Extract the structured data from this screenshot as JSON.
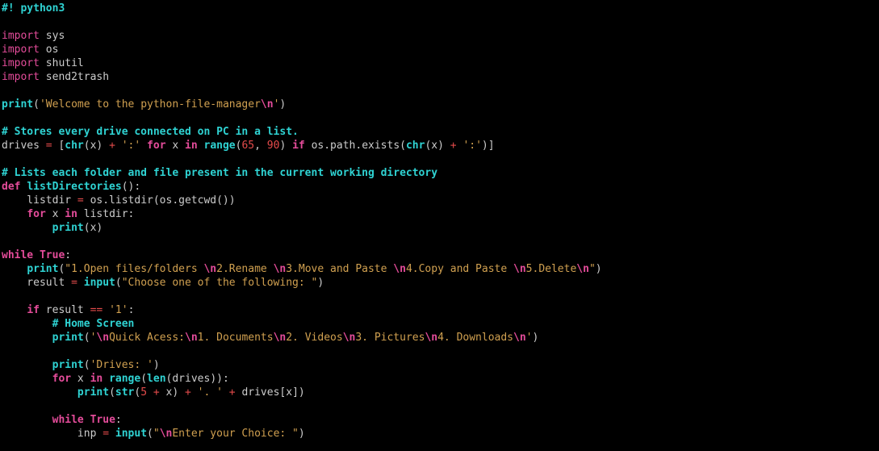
{
  "lines": [
    [
      {
        "cls": "cyan bold",
        "t": "#! python3"
      }
    ],
    [
      {
        "cls": "grey",
        "t": ""
      }
    ],
    [
      {
        "cls": "magenta",
        "t": "import"
      },
      {
        "cls": "grey",
        "t": " sys"
      }
    ],
    [
      {
        "cls": "magenta",
        "t": "import"
      },
      {
        "cls": "grey",
        "t": " os"
      }
    ],
    [
      {
        "cls": "magenta",
        "t": "import"
      },
      {
        "cls": "grey",
        "t": " shutil"
      }
    ],
    [
      {
        "cls": "magenta",
        "t": "import"
      },
      {
        "cls": "grey",
        "t": " send2trash"
      }
    ],
    [
      {
        "cls": "grey",
        "t": ""
      }
    ],
    [
      {
        "cls": "cyan bold",
        "t": "print"
      },
      {
        "cls": "grey",
        "t": "("
      },
      {
        "cls": "orange",
        "t": "'Welcome to the python-file-manager"
      },
      {
        "cls": "magenta bold",
        "t": "\\n"
      },
      {
        "cls": "orange",
        "t": "'"
      },
      {
        "cls": "grey",
        "t": ")"
      }
    ],
    [
      {
        "cls": "grey",
        "t": ""
      }
    ],
    [
      {
        "cls": "cyan bold",
        "t": "# Stores every drive connected on PC in a list."
      }
    ],
    [
      {
        "cls": "grey",
        "t": "drives "
      },
      {
        "cls": "red",
        "t": "="
      },
      {
        "cls": "grey",
        "t": " ["
      },
      {
        "cls": "cyan bold",
        "t": "chr"
      },
      {
        "cls": "grey",
        "t": "(x) "
      },
      {
        "cls": "red",
        "t": "+"
      },
      {
        "cls": "grey",
        "t": " "
      },
      {
        "cls": "orange",
        "t": "':'"
      },
      {
        "cls": "grey",
        "t": " "
      },
      {
        "cls": "magenta bold",
        "t": "for"
      },
      {
        "cls": "grey",
        "t": " x "
      },
      {
        "cls": "magenta bold",
        "t": "in"
      },
      {
        "cls": "grey",
        "t": " "
      },
      {
        "cls": "cyan bold",
        "t": "range"
      },
      {
        "cls": "grey",
        "t": "("
      },
      {
        "cls": "red",
        "t": "65"
      },
      {
        "cls": "grey",
        "t": ", "
      },
      {
        "cls": "red",
        "t": "90"
      },
      {
        "cls": "grey",
        "t": ") "
      },
      {
        "cls": "magenta bold",
        "t": "if"
      },
      {
        "cls": "grey",
        "t": " os.path.exists("
      },
      {
        "cls": "cyan bold",
        "t": "chr"
      },
      {
        "cls": "grey",
        "t": "(x) "
      },
      {
        "cls": "red",
        "t": "+"
      },
      {
        "cls": "grey",
        "t": " "
      },
      {
        "cls": "orange",
        "t": "':'"
      },
      {
        "cls": "grey",
        "t": ")]"
      }
    ],
    [
      {
        "cls": "grey",
        "t": ""
      }
    ],
    [
      {
        "cls": "cyan bold",
        "t": "# Lists each folder and file present in the current working directory"
      }
    ],
    [
      {
        "cls": "magenta bold",
        "t": "def"
      },
      {
        "cls": "grey",
        "t": " "
      },
      {
        "cls": "cyan bold",
        "t": "listDirectories"
      },
      {
        "cls": "grey",
        "t": "():"
      }
    ],
    [
      {
        "cls": "grey",
        "t": "    listdir "
      },
      {
        "cls": "red",
        "t": "="
      },
      {
        "cls": "grey",
        "t": " os.listdir(os.getcwd())"
      }
    ],
    [
      {
        "cls": "grey",
        "t": "    "
      },
      {
        "cls": "magenta bold",
        "t": "for"
      },
      {
        "cls": "grey",
        "t": " x "
      },
      {
        "cls": "magenta bold",
        "t": "in"
      },
      {
        "cls": "grey",
        "t": " listdir:"
      }
    ],
    [
      {
        "cls": "grey",
        "t": "        "
      },
      {
        "cls": "cyan bold",
        "t": "print"
      },
      {
        "cls": "grey",
        "t": "(x)"
      }
    ],
    [
      {
        "cls": "grey",
        "t": ""
      }
    ],
    [
      {
        "cls": "magenta bold",
        "t": "while"
      },
      {
        "cls": "grey",
        "t": " "
      },
      {
        "cls": "magenta bold",
        "t": "True"
      },
      {
        "cls": "grey",
        "t": ":"
      }
    ],
    [
      {
        "cls": "grey",
        "t": "    "
      },
      {
        "cls": "cyan bold",
        "t": "print"
      },
      {
        "cls": "grey",
        "t": "("
      },
      {
        "cls": "orange",
        "t": "\"1.Open files/folders "
      },
      {
        "cls": "magenta bold",
        "t": "\\n"
      },
      {
        "cls": "orange",
        "t": "2.Rename "
      },
      {
        "cls": "magenta bold",
        "t": "\\n"
      },
      {
        "cls": "orange",
        "t": "3.Move and Paste "
      },
      {
        "cls": "magenta bold",
        "t": "\\n"
      },
      {
        "cls": "orange",
        "t": "4.Copy and Paste "
      },
      {
        "cls": "magenta bold",
        "t": "\\n"
      },
      {
        "cls": "orange",
        "t": "5.Delete"
      },
      {
        "cls": "magenta bold",
        "t": "\\n"
      },
      {
        "cls": "orange",
        "t": "\""
      },
      {
        "cls": "grey",
        "t": ")"
      }
    ],
    [
      {
        "cls": "grey",
        "t": "    result "
      },
      {
        "cls": "red",
        "t": "="
      },
      {
        "cls": "grey",
        "t": " "
      },
      {
        "cls": "cyan bold",
        "t": "input"
      },
      {
        "cls": "grey",
        "t": "("
      },
      {
        "cls": "orange",
        "t": "\"Choose one of the following: \""
      },
      {
        "cls": "grey",
        "t": ")"
      }
    ],
    [
      {
        "cls": "grey",
        "t": ""
      }
    ],
    [
      {
        "cls": "grey",
        "t": "    "
      },
      {
        "cls": "magenta bold",
        "t": "if"
      },
      {
        "cls": "grey",
        "t": " result "
      },
      {
        "cls": "red",
        "t": "=="
      },
      {
        "cls": "grey",
        "t": " "
      },
      {
        "cls": "orange",
        "t": "'1'"
      },
      {
        "cls": "grey",
        "t": ":"
      }
    ],
    [
      {
        "cls": "grey",
        "t": "        "
      },
      {
        "cls": "cyan bold",
        "t": "# Home Screen"
      }
    ],
    [
      {
        "cls": "grey",
        "t": "        "
      },
      {
        "cls": "cyan bold",
        "t": "print"
      },
      {
        "cls": "grey",
        "t": "("
      },
      {
        "cls": "orange",
        "t": "'"
      },
      {
        "cls": "magenta bold",
        "t": "\\n"
      },
      {
        "cls": "orange",
        "t": "Quick Acess:"
      },
      {
        "cls": "magenta bold",
        "t": "\\n"
      },
      {
        "cls": "orange",
        "t": "1. Documents"
      },
      {
        "cls": "magenta bold",
        "t": "\\n"
      },
      {
        "cls": "orange",
        "t": "2. Videos"
      },
      {
        "cls": "magenta bold",
        "t": "\\n"
      },
      {
        "cls": "orange",
        "t": "3. Pictures"
      },
      {
        "cls": "magenta bold",
        "t": "\\n"
      },
      {
        "cls": "orange",
        "t": "4. Downloads"
      },
      {
        "cls": "magenta bold",
        "t": "\\n"
      },
      {
        "cls": "orange",
        "t": "'"
      },
      {
        "cls": "grey",
        "t": ")"
      }
    ],
    [
      {
        "cls": "grey",
        "t": ""
      }
    ],
    [
      {
        "cls": "grey",
        "t": "        "
      },
      {
        "cls": "cyan bold",
        "t": "print"
      },
      {
        "cls": "grey",
        "t": "("
      },
      {
        "cls": "orange",
        "t": "'Drives: '"
      },
      {
        "cls": "grey",
        "t": ")"
      }
    ],
    [
      {
        "cls": "grey",
        "t": "        "
      },
      {
        "cls": "magenta bold",
        "t": "for"
      },
      {
        "cls": "grey",
        "t": " x "
      },
      {
        "cls": "magenta bold",
        "t": "in"
      },
      {
        "cls": "grey",
        "t": " "
      },
      {
        "cls": "cyan bold",
        "t": "range"
      },
      {
        "cls": "grey",
        "t": "("
      },
      {
        "cls": "cyan bold",
        "t": "len"
      },
      {
        "cls": "grey",
        "t": "(drives)):"
      }
    ],
    [
      {
        "cls": "grey",
        "t": "            "
      },
      {
        "cls": "cyan bold",
        "t": "print"
      },
      {
        "cls": "grey",
        "t": "("
      },
      {
        "cls": "cyan bold",
        "t": "str"
      },
      {
        "cls": "grey",
        "t": "("
      },
      {
        "cls": "red",
        "t": "5"
      },
      {
        "cls": "grey",
        "t": " "
      },
      {
        "cls": "red",
        "t": "+"
      },
      {
        "cls": "grey",
        "t": " x) "
      },
      {
        "cls": "red",
        "t": "+"
      },
      {
        "cls": "grey",
        "t": " "
      },
      {
        "cls": "orange",
        "t": "'. '"
      },
      {
        "cls": "grey",
        "t": " "
      },
      {
        "cls": "red",
        "t": "+"
      },
      {
        "cls": "grey",
        "t": " drives[x])"
      }
    ],
    [
      {
        "cls": "grey",
        "t": ""
      }
    ],
    [
      {
        "cls": "grey",
        "t": "        "
      },
      {
        "cls": "magenta bold",
        "t": "while"
      },
      {
        "cls": "grey",
        "t": " "
      },
      {
        "cls": "magenta bold",
        "t": "True"
      },
      {
        "cls": "grey",
        "t": ":"
      }
    ],
    [
      {
        "cls": "grey",
        "t": "            inp "
      },
      {
        "cls": "red",
        "t": "="
      },
      {
        "cls": "grey",
        "t": " "
      },
      {
        "cls": "cyan bold",
        "t": "input"
      },
      {
        "cls": "grey",
        "t": "("
      },
      {
        "cls": "orange",
        "t": "\""
      },
      {
        "cls": "magenta bold",
        "t": "\\n"
      },
      {
        "cls": "orange",
        "t": "Enter your Choice: \""
      },
      {
        "cls": "grey",
        "t": ")"
      }
    ]
  ]
}
